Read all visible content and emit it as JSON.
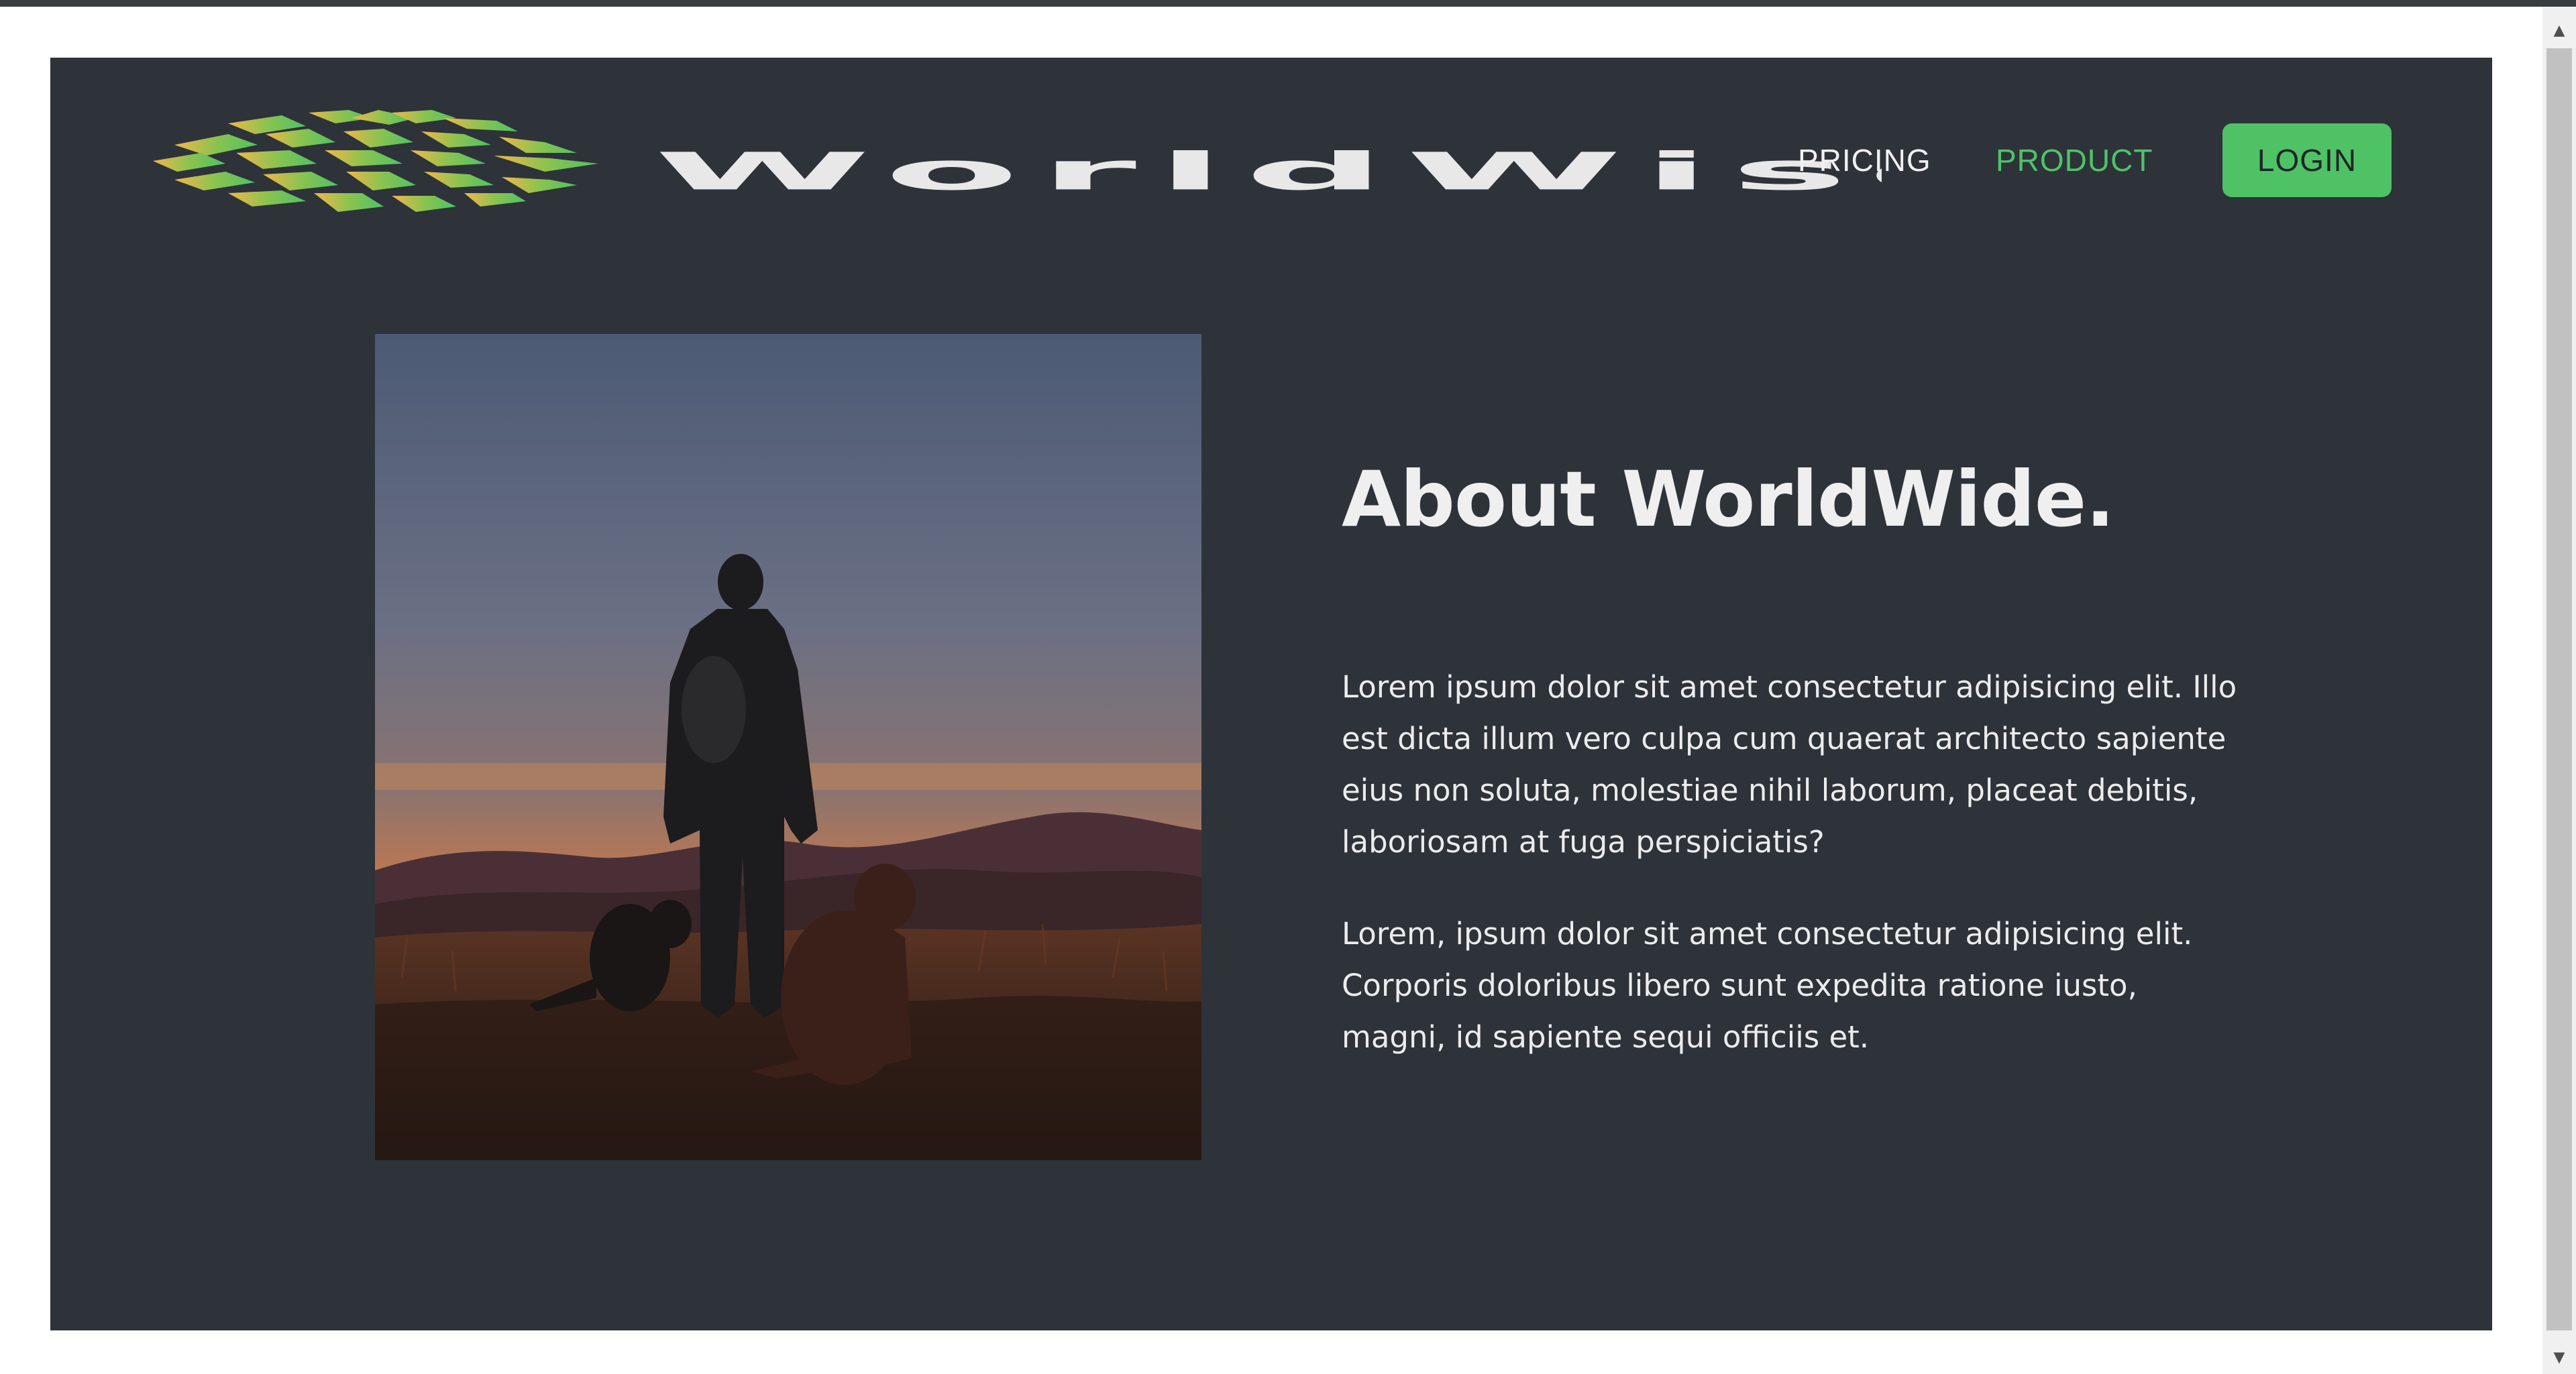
{
  "brand": {
    "name": "WorldWise",
    "logo_icon": "worldwise-logo-icon"
  },
  "nav": {
    "pricing": "PRICING",
    "product": "PRODUCT",
    "login": "LOGIN"
  },
  "about": {
    "title": "About WorldWide.",
    "paragraph1": "Lorem ipsum dolor sit amet consectetur adipisicing elit. Illo est dicta illum vero culpa cum quaerat architecto sapiente eius non soluta, molestiae nihil laborum, placeat debitis, laboriosam at fuga perspiciatis?",
    "paragraph2": "Lorem, ipsum dolor sit amet consectetur adipisicing elit. Corporis doloribus libero sunt expedita ratione iusto, magni, id sapiente sequi officiis et."
  },
  "colors": {
    "background": "#2d3339",
    "accent": "#4ec265",
    "text": "#ececec"
  },
  "scrollbar": {
    "up_icon": "chevron-up-icon",
    "down_icon": "chevron-down-icon"
  }
}
